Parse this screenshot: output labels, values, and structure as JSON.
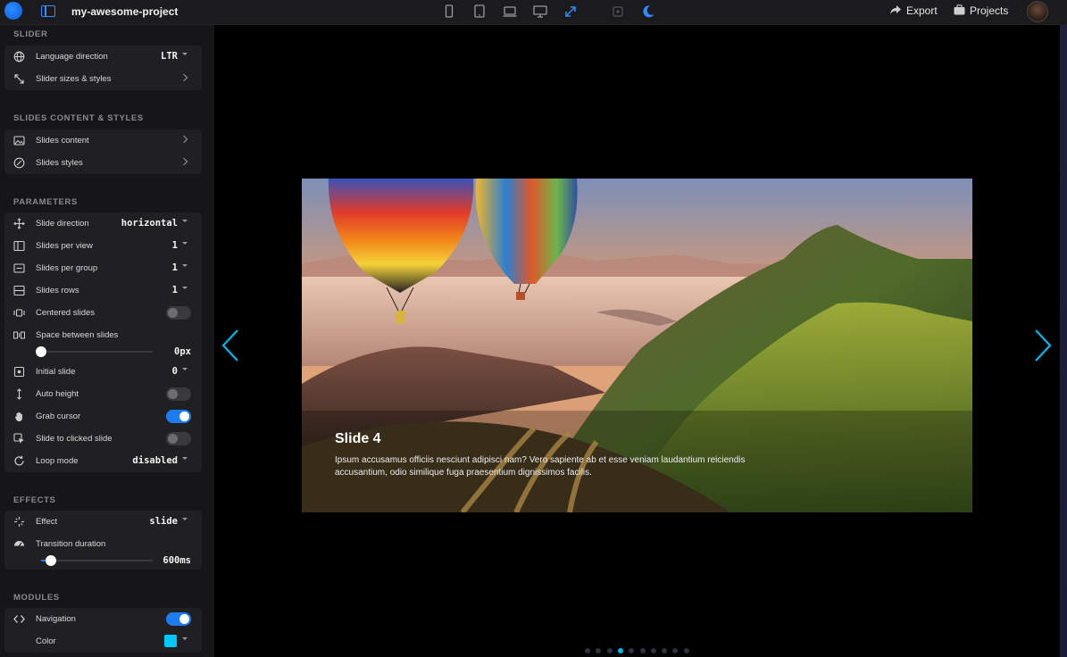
{
  "topbar": {
    "project_name": "my-awesome-project",
    "export_label": "Export",
    "projects_label": "Projects"
  },
  "sidebar": {
    "slider": {
      "title": "SLIDER",
      "rows": [
        {
          "label": "Language direction",
          "value": "LTR"
        },
        {
          "label": "Slider sizes & styles"
        }
      ]
    },
    "slides_content": {
      "title": "SLIDES CONTENT & STYLES",
      "rows": [
        {
          "label": "Slides content"
        },
        {
          "label": "Slides styles"
        }
      ]
    },
    "parameters": {
      "title": "PARAMETERS",
      "rows": [
        {
          "label": "Slide direction",
          "value": "horizontal"
        },
        {
          "label": "Slides per view",
          "value": "1"
        },
        {
          "label": "Slides per group",
          "value": "1"
        },
        {
          "label": "Slides rows",
          "value": "1"
        },
        {
          "label": "Centered slides",
          "toggle": false
        },
        {
          "label": "Space between slides",
          "value": "0px",
          "slider_fraction": 0
        },
        {
          "label": "Initial slide",
          "value": "0"
        },
        {
          "label": "Auto height",
          "toggle": false
        },
        {
          "label": "Grab cursor",
          "toggle": true
        },
        {
          "label": "Slide to clicked slide",
          "toggle": false
        },
        {
          "label": "Loop mode",
          "value": "disabled"
        }
      ]
    },
    "effects": {
      "title": "EFFECTS",
      "rows": [
        {
          "label": "Effect",
          "value": "slide"
        },
        {
          "label": "Transition duration",
          "value": "600ms",
          "slider_fraction": 0.09
        }
      ]
    },
    "modules": {
      "title": "MODULES",
      "rows": [
        {
          "label": "Navigation",
          "toggle": true
        },
        {
          "label": "Color",
          "color": "#00c8ff"
        }
      ]
    }
  },
  "slide": {
    "title": "Slide 4",
    "text": "Ipsum accusamus officiis nesciunt adipisci nam? Vero sapiente ab et esse veniam laudantium reiciendis accusantium, odio similique fuga praesentium dignissimos facilis."
  },
  "pagination": {
    "count": 10,
    "active_index": 3
  },
  "colors": {
    "accent": "#1d7cf2",
    "nav_arrow": "#00b8f0"
  }
}
